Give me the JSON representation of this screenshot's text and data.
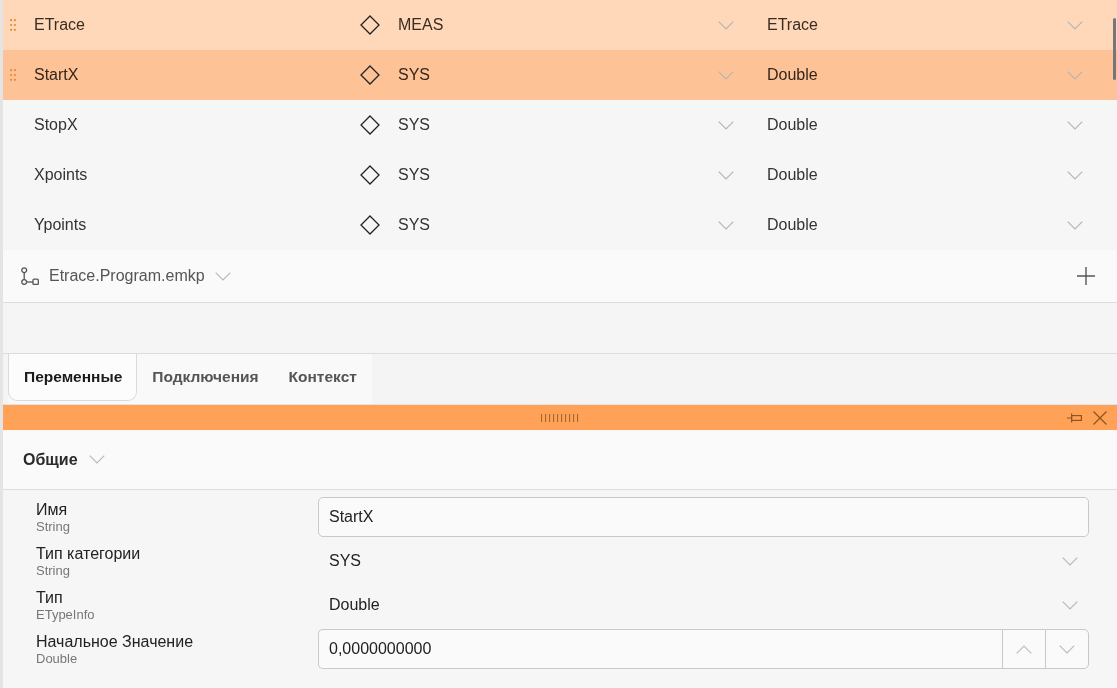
{
  "variables": {
    "rows": [
      {
        "name": "ETrace",
        "category": "MEAS",
        "type": "ETrace",
        "hovered": true,
        "selected": false
      },
      {
        "name": "StartX",
        "category": "SYS",
        "type": "Double",
        "hovered": false,
        "selected": true
      },
      {
        "name": "StopX",
        "category": "SYS",
        "type": "Double",
        "hovered": false,
        "selected": false
      },
      {
        "name": "Xpoints",
        "category": "SYS",
        "type": "Double",
        "hovered": false,
        "selected": false
      },
      {
        "name": "Ypoints",
        "category": "SYS",
        "type": "Double",
        "hovered": false,
        "selected": false
      }
    ]
  },
  "program_bar": {
    "file": "Etrace.Program.emkp"
  },
  "tabs": [
    {
      "label": "Переменные",
      "selected": true
    },
    {
      "label": "Подключения",
      "selected": false
    },
    {
      "label": "Контекст",
      "selected": false
    }
  ],
  "properties_panel": {
    "section": {
      "title": "Общие",
      "expanded": true
    },
    "properties": [
      {
        "kind": "text",
        "label": "Имя",
        "type": "String",
        "value": "StartX"
      },
      {
        "kind": "dropdown",
        "label": "Тип категории",
        "type": "String",
        "value": "SYS"
      },
      {
        "kind": "dropdown",
        "label": "Тип",
        "type": "ETypeInfo",
        "value": "Double"
      },
      {
        "kind": "number",
        "label": "Начальное Значение",
        "type": "Double",
        "value": "0,0000000000"
      }
    ]
  }
}
